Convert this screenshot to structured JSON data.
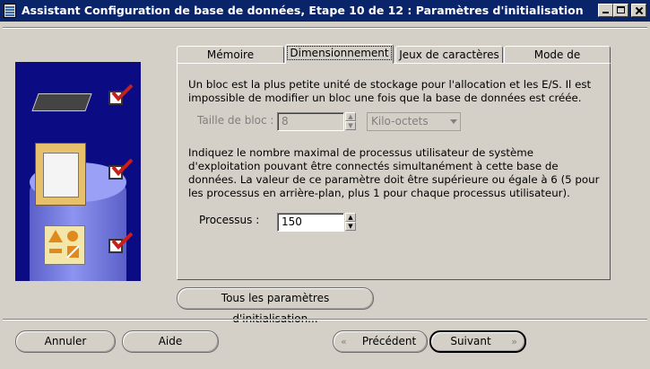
{
  "window": {
    "title": "Assistant Configuration de base de données, Etape 10 de 12 : Paramètres d'initialisation"
  },
  "tabs": [
    {
      "label": "Mémoire",
      "selected": false
    },
    {
      "label": "Dimensionnement",
      "selected": true
    },
    {
      "label": "Jeux de caractères",
      "selected": false
    },
    {
      "label": "Mode de connexion",
      "selected": false
    }
  ],
  "block": {
    "description": "Un bloc est la plus petite unité de stockage pour l'allocation et les E/S. Il est impossible de modifier un bloc une fois que la base de données est créée.",
    "size_label": "Taille de bloc :",
    "size_value": "8",
    "unit_value": "Kilo-octets"
  },
  "processes": {
    "description": "Indiquez le nombre maximal de processus utilisateur de système d'exploitation pouvant être connectés simultanément à cette base de données. La valeur de ce paramètre doit être supérieure ou égale à 6 (5 pour les processus en arrière-plan, plus 1 pour chaque processus utilisateur).",
    "label": "Processus :",
    "value": "150"
  },
  "buttons": {
    "all_params": "Tous les paramètres d'initialisation...",
    "cancel": "Annuler",
    "help": "Aide",
    "previous": "Précédent",
    "next": "Suivant"
  },
  "colors": {
    "titlebar": "#0a246a",
    "side_panel": "#0b0c83",
    "check_mark": "#c81e1e",
    "face": "#d4d0c8"
  },
  "icons": {
    "app": "app-icon",
    "memory": "memory-chip-icon",
    "folder": "documents-folder-icon",
    "shapes": "shapes-icon",
    "check": "red-check-icon"
  }
}
